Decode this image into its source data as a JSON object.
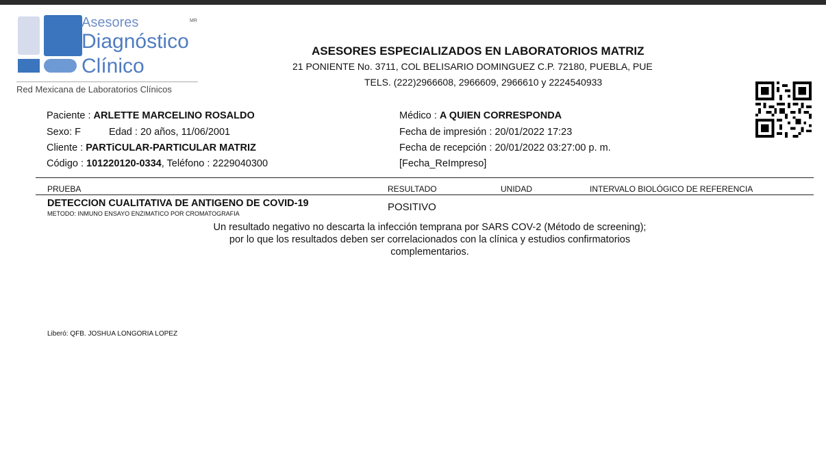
{
  "logo": {
    "line1": "Asesores",
    "line2": "Diagnóstico",
    "line3": "Clínico",
    "tm": "MR",
    "tagline": "Red Mexicana de Laboratorios Clínicos",
    "colors": {
      "primary": "#3a75bd",
      "light": "#d7dced",
      "text": "#4f7cc0"
    }
  },
  "header": {
    "title": "ASESORES ESPECIALIZADOS EN LABORATORIOS MATRIZ",
    "address": "21 PONIENTE No. 3711, COL BELISARIO DOMINGUEZ C.P. 72180, PUEBLA, PUE",
    "phones": "TELS. (222)2966608, 2966609, 2966610 y 2224540933"
  },
  "qr_icon": "qr-code-icon",
  "patient": {
    "paciente_label": "Paciente : ",
    "paciente_value": "ARLETTE MARCELINO ROSALDO",
    "sexo_label": "Sexo: ",
    "sexo_value": "F",
    "edad_label": "Edad : ",
    "edad_value": "20 años, 11/06/2001",
    "cliente_label": "Cliente : ",
    "cliente_value": "PARTiCULAR-PARTICULAR MATRIZ",
    "codigo_label": "Código : ",
    "codigo_value": "101220120-0334",
    "telefono_label": ", Teléfono : ",
    "telefono_value": "2229040300"
  },
  "doctor": {
    "medico_label": "Médico : ",
    "medico_value": "A QUIEN CORRESPONDA",
    "impresion": "Fecha de impresión : 20/01/2022 17:23",
    "recepcion": "Fecha de recepción : 20/01/2022 03:27:00 p. m.",
    "reimpreso": "[Fecha_ReImpreso]"
  },
  "table": {
    "columns": [
      "PRUEBA",
      "RESULTADO",
      "UNIDAD",
      "INTERVALO BIOLÓGICO DE REFERENCIA"
    ],
    "test_name": "DETECCION CUALITATIVA DE ANTIGENO DE COVID-19",
    "method": "METODO: INMUNO ENSAYO ENZIMATICO POR CROMATOGRAFIA",
    "result": "POSITIVO",
    "note": [
      "Un resultado negativo no descarta la infección temprana por SARS COV-2 (Método de screening);",
      "por lo que los resultados deben ser correlacionados con la clínica y estudios confirmatorios",
      "complementarios."
    ]
  },
  "released_by": "Liberó: QFB. JOSHUA LONGORIA LOPEZ"
}
